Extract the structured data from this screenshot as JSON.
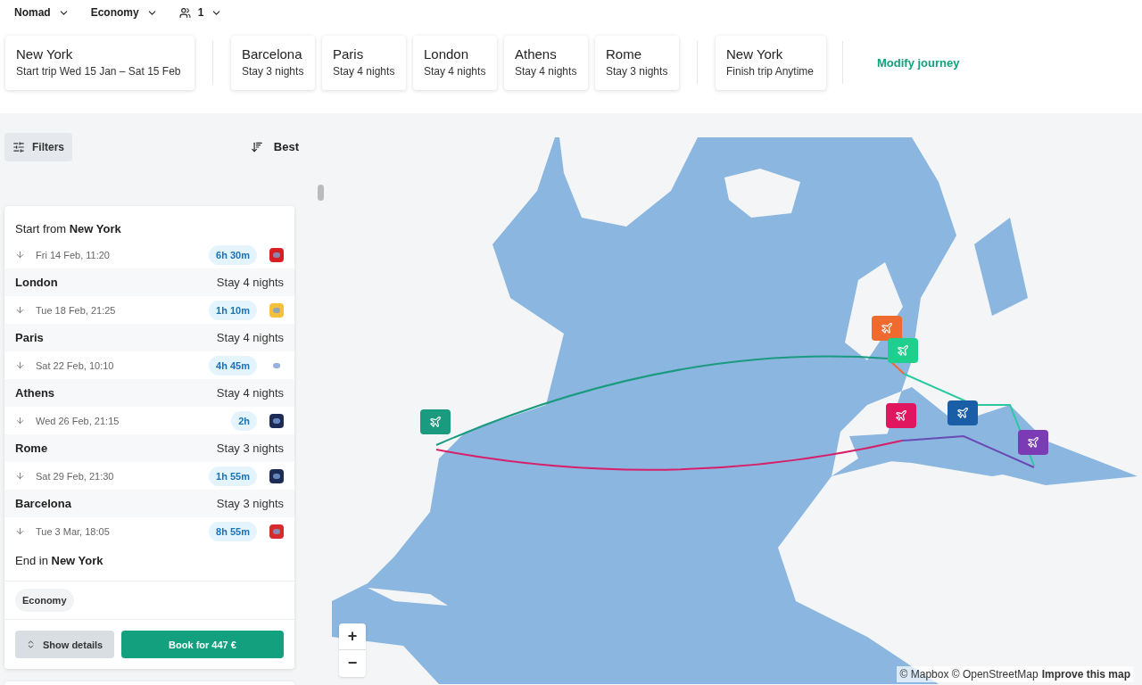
{
  "options": [
    {
      "label": "Nomad",
      "kind": "plain"
    },
    {
      "label": "Economy",
      "kind": "plain"
    },
    {
      "label": "1",
      "kind": "travelers"
    }
  ],
  "journey": {
    "start": {
      "city": "New York",
      "detail": "Start trip Wed 15 Jan – Sat 15 Feb"
    },
    "stops": [
      {
        "city": "Barcelona",
        "detail": "Stay 3 nights"
      },
      {
        "city": "Paris",
        "detail": "Stay 4 nights"
      },
      {
        "city": "London",
        "detail": "Stay 4 nights"
      },
      {
        "city": "Athens",
        "detail": "Stay 4 nights"
      },
      {
        "city": "Rome",
        "detail": "Stay 3 nights"
      }
    ],
    "end": {
      "city": "New York",
      "detail": "Finish trip Anytime"
    },
    "modify": "Modify journey"
  },
  "sidebar": {
    "filters": "Filters",
    "sort": "Best",
    "itinerary": {
      "start_prefix": "Start from",
      "start_city": "New York",
      "segments": [
        {
          "kind": "leg",
          "date": "Fri 14 Feb, 11:20",
          "duration": "6h 30m",
          "color": "#d81f26"
        },
        {
          "kind": "stop",
          "city": "London",
          "stay": "Stay 4 nights"
        },
        {
          "kind": "leg",
          "date": "Tue 18 Feb, 21:25",
          "duration": "1h 10m",
          "color": "#f5c13b"
        },
        {
          "kind": "stop",
          "city": "Paris",
          "stay": "Stay 4 nights"
        },
        {
          "kind": "leg",
          "date": "Sat 22 Feb, 10:10",
          "duration": "4h 45m",
          "color": "#ffffff"
        },
        {
          "kind": "stop",
          "city": "Athens",
          "stay": "Stay 4 nights"
        },
        {
          "kind": "leg",
          "date": "Wed 26 Feb, 21:15",
          "duration": "2h",
          "color": "#1c2c54"
        },
        {
          "kind": "stop",
          "city": "Rome",
          "stay": "Stay 3 nights"
        },
        {
          "kind": "leg",
          "date": "Sat 29 Feb, 21:30",
          "duration": "1h 55m",
          "color": "#1c2c54"
        },
        {
          "kind": "stop",
          "city": "Barcelona",
          "stay": "Stay 3 nights"
        },
        {
          "kind": "leg",
          "date": "Tue 3 Mar, 18:05",
          "duration": "8h 55m",
          "color": "#d62b2b"
        }
      ],
      "end_prefix": "End in",
      "end_city": "New York",
      "cabin": "Economy",
      "details_button": "Show details",
      "book_button": "Book for 447 €"
    }
  },
  "map": {
    "markers": [
      {
        "color": "#1a9a7f"
      },
      {
        "color": "#ef6a2e"
      },
      {
        "color": "#1fd08c"
      },
      {
        "color": "#e0175e"
      },
      {
        "color": "#1a5ea8"
      },
      {
        "color": "#7b3bb5"
      }
    ],
    "zoom_in": "+",
    "zoom_out": "−",
    "attribution": "© Mapbox © OpenStreetMap",
    "improve": "Improve this map"
  }
}
